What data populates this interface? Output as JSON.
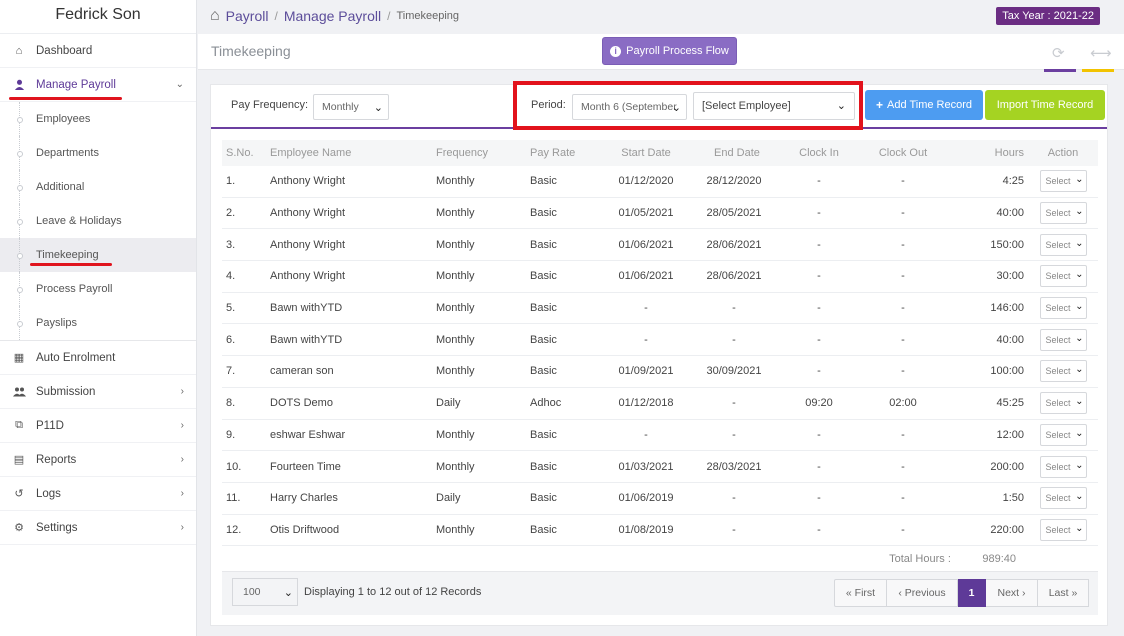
{
  "sidebar": {
    "brand": "Fedrick Son",
    "items": [
      {
        "label": "Dashboard",
        "icon": "home-icon"
      },
      {
        "label": "Manage Payroll",
        "icon": "user-icon"
      },
      {
        "label": "Auto Enrolment",
        "icon": "grid-icon"
      },
      {
        "label": "Submission",
        "icon": "users-icon"
      },
      {
        "label": "P11D",
        "icon": "copy-icon"
      },
      {
        "label": "Reports",
        "icon": "report-icon"
      },
      {
        "label": "Logs",
        "icon": "history-icon"
      },
      {
        "label": "Settings",
        "icon": "gear-icon"
      }
    ],
    "submenu": [
      "Employees",
      "Departments",
      "Additional",
      "Leave & Holidays",
      "Timekeeping",
      "Process Payroll",
      "Payslips"
    ]
  },
  "breadcrumb": {
    "root": "Payroll",
    "middle": "Manage Payroll",
    "current": "Timekeeping"
  },
  "tax_year": "Tax Year : 2021-22",
  "section": {
    "title": "Timekeeping",
    "flow_button": "Payroll Process Flow"
  },
  "toolbar": {
    "pay_frequency_label": "Pay Frequency:",
    "pay_frequency_value": "Monthly",
    "period_label": "Period:",
    "period_value": "Month 6 (September",
    "employee_value": "[Select Employee]",
    "add_button": "Add Time Record",
    "import_button": "Import Time Record"
  },
  "table": {
    "headers": [
      "S.No.",
      "Employee Name",
      "Frequency",
      "Pay Rate",
      "Start Date",
      "End Date",
      "Clock In",
      "Clock Out",
      "Hours",
      "Action"
    ],
    "rows": [
      [
        "1.",
        "Anthony Wright",
        "Monthly",
        "Basic",
        "01/12/2020",
        "28/12/2020",
        "-",
        "-",
        "4:25",
        "Select"
      ],
      [
        "2.",
        "Anthony Wright",
        "Monthly",
        "Basic",
        "01/05/2021",
        "28/05/2021",
        "-",
        "-",
        "40:00",
        "Select"
      ],
      [
        "3.",
        "Anthony Wright",
        "Monthly",
        "Basic",
        "01/06/2021",
        "28/06/2021",
        "-",
        "-",
        "150:00",
        "Select"
      ],
      [
        "4.",
        "Anthony Wright",
        "Monthly",
        "Basic",
        "01/06/2021",
        "28/06/2021",
        "-",
        "-",
        "30:00",
        "Select"
      ],
      [
        "5.",
        "Bawn withYTD",
        "Monthly",
        "Basic",
        "-",
        "-",
        "-",
        "-",
        "146:00",
        "Select"
      ],
      [
        "6.",
        "Bawn withYTD",
        "Monthly",
        "Basic",
        "-",
        "-",
        "-",
        "-",
        "40:00",
        "Select"
      ],
      [
        "7.",
        "cameran son",
        "Monthly",
        "Basic",
        "01/09/2021",
        "30/09/2021",
        "-",
        "-",
        "100:00",
        "Select"
      ],
      [
        "8.",
        "DOTS Demo",
        "Daily",
        "Adhoc",
        "01/12/2018",
        "-",
        "09:20",
        "02:00",
        "45:25",
        "Select"
      ],
      [
        "9.",
        "eshwar Eshwar",
        "Monthly",
        "Basic",
        "-",
        "-",
        "-",
        "-",
        "12:00",
        "Select"
      ],
      [
        "10.",
        "Fourteen Time",
        "Monthly",
        "Basic",
        "01/03/2021",
        "28/03/2021",
        "-",
        "-",
        "200:00",
        "Select"
      ],
      [
        "11.",
        "Harry Charles",
        "Daily",
        "Basic",
        "01/06/2019",
        "-",
        "-",
        "-",
        "1:50",
        "Select"
      ],
      [
        "12.",
        "Otis Driftwood",
        "Monthly",
        "Basic",
        "01/08/2019",
        "-",
        "-",
        "-",
        "220:00",
        "Select"
      ]
    ],
    "total_label": "Total Hours :",
    "total_value": "989:40"
  },
  "footer": {
    "page_size": "100",
    "display_text": "Displaying 1 to 12 out of 12 Records",
    "pager": [
      "« First",
      "‹ Previous",
      "1",
      "Next ›",
      "Last »"
    ]
  },
  "colors": {
    "accent": "#5e3a98",
    "tax_badge": "#6b2d83",
    "add_button": "#4d9cf1",
    "import_button": "#a5d322",
    "highlight": "#e2121c"
  }
}
